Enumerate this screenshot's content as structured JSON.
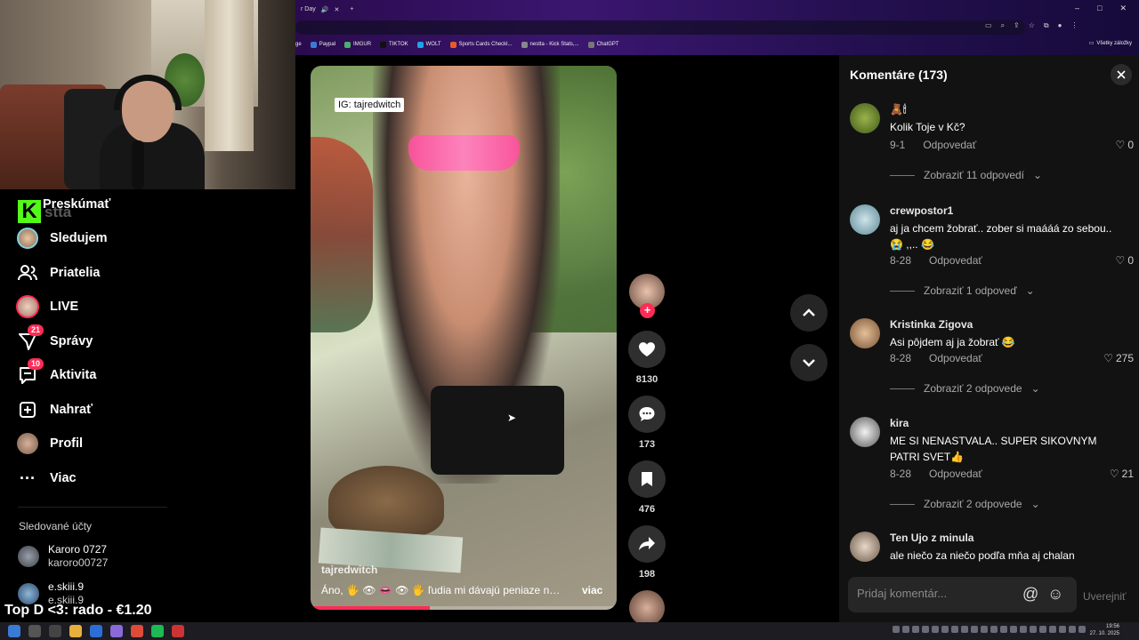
{
  "browser": {
    "tab_title": "r Day",
    "bookmarks": [
      "ge",
      "Paypal",
      "IMGUR",
      "TIKTOK",
      "WOLT",
      "Sports Cards Checkl...",
      "nestta - Kick Stats,...",
      "ChatGPT"
    ],
    "all_bookmarks": "Všetky záložky"
  },
  "stream": {
    "logo_letter": "K",
    "logo_word": "stta",
    "donation": "Top D <3: rado - €1.20"
  },
  "nav": {
    "items": [
      {
        "label": "Preskúmať",
        "icon": "explore-icon"
      },
      {
        "label": "Sledujem",
        "icon": "following-avatar-icon"
      },
      {
        "label": "Priatelia",
        "icon": "friends-icon"
      },
      {
        "label": "LIVE",
        "icon": "live-avatar-icon"
      },
      {
        "label": "Správy",
        "icon": "messages-icon",
        "badge": "21"
      },
      {
        "label": "Aktivita",
        "icon": "activity-icon",
        "badge": "10"
      },
      {
        "label": "Nahrať",
        "icon": "upload-icon"
      },
      {
        "label": "Profil",
        "icon": "profile-avatar-icon"
      },
      {
        "label": "Viac",
        "icon": "more-icon"
      }
    ],
    "following_title": "Sledované účty",
    "following": [
      {
        "name": "Karoro 0727",
        "handle": "karoro00727"
      },
      {
        "name": "e.skiii.9",
        "handle": "e.skiii.9"
      }
    ]
  },
  "video": {
    "ig_tag": "IG: tajredwitch",
    "author": "tajredwitch",
    "caption": "Áno, 🖐 👁 👄 👁 🖐 ľudia mi dávajú peniaze na ...",
    "more_label": "viac",
    "progress": 0.39,
    "likes": "8130",
    "comments": "173",
    "saves": "476",
    "shares": "198"
  },
  "comments": {
    "title": "Komentáre (173)",
    "reply_label": "Odpovedať",
    "items": [
      {
        "user": "🧸🕯",
        "text": "Kolik Toje v Kč?",
        "date": "9-1",
        "likes": "0",
        "replies": "Zobraziť 11 odpovedí"
      },
      {
        "user": "crewpostor1",
        "text": "aj ja chcem žobrať.. zober si maááá zo sebou.. 😭 ,,.. 😂",
        "date": "8-28",
        "likes": "0",
        "replies": "Zobraziť 1 odpoveď"
      },
      {
        "user": "Kristinka Zigova",
        "text": "Asi pôjdem aj ja žobrať 😂",
        "date": "8-28",
        "likes": "275",
        "replies": "Zobraziť 2 odpovede"
      },
      {
        "user": "kira",
        "text": "ME SI NENASTVALA.. SUPER SIKOVNYM PATRI SVET👍",
        "date": "8-28",
        "likes": "21",
        "replies": "Zobraziť 2 odpovede"
      },
      {
        "user": "Ten Ujo z minula",
        "text": "ale niečo za niečo podľa mňa aj chalan"
      }
    ],
    "input_placeholder": "Pridaj komentár...",
    "post_label": "Uverejniť"
  },
  "taskbar": {
    "time": "19:56",
    "date": "27. 10. 2025"
  }
}
